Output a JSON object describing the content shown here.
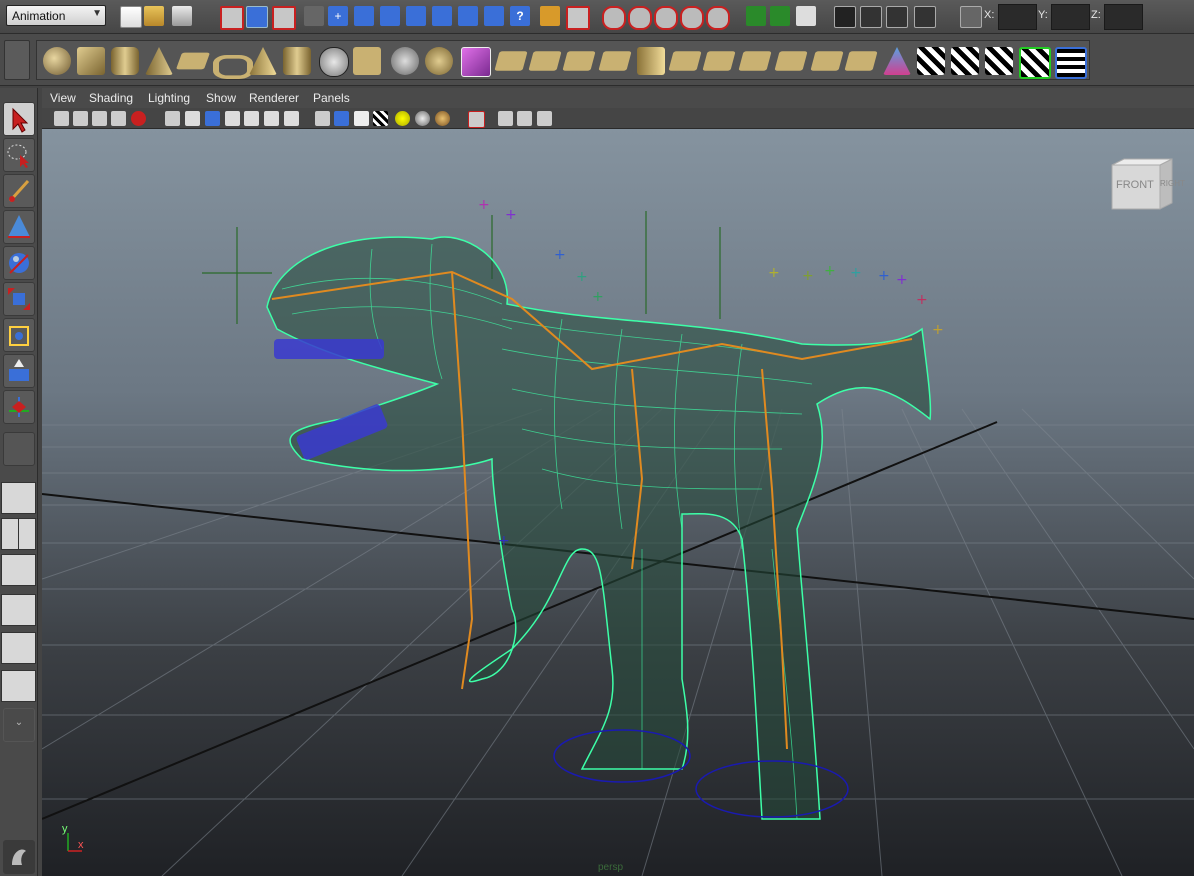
{
  "status_line": {
    "mode": "Animation",
    "coord_labels": [
      "X:",
      "Y:",
      "Z:"
    ]
  },
  "panel": {
    "menus": [
      "View",
      "Shading",
      "Lighting",
      "Show",
      "Renderer",
      "Panels"
    ]
  },
  "viewport": {
    "view_cube_label": "FRONT",
    "view_cube_side": "RIGHT",
    "camera_label": "persp",
    "axis_x": "x",
    "axis_y": "y",
    "background_top": "#85939f",
    "background_bottom": "#1f2125",
    "mesh_color": "#3dffa8",
    "grid_color": "#7f8790"
  },
  "colors": {
    "accent_red": "#c82020",
    "accent_blue": "#3a6fd8",
    "ui_bg": "#4a4a4a"
  },
  "icons": {
    "statusline": [
      "new-scene-icon",
      "open-scene-icon",
      "save-scene-icon",
      "select-by-hierarchy-icon",
      "select-by-object-icon",
      "select-by-component-icon",
      "mask-icon",
      "select-handle-icon",
      "select-joint-icon",
      "select-curve-icon",
      "select-surface-icon",
      "select-deformation-icon",
      "select-dynamic-icon",
      "select-rendering-icon",
      "lock-icon",
      "highlight-icon",
      "snap-grid-icon",
      "snap-curve-icon",
      "snap-point-icon",
      "snap-view-plane-icon",
      "snap-live-icon",
      "input-icon",
      "output-icon",
      "history-icon",
      "render-view-icon",
      "render-frame-icon",
      "ipr-icon",
      "render-settings-icon",
      "input-line-icon"
    ],
    "shelf": [
      "nurbs-sphere-icon",
      "nurbs-cube-icon",
      "nurbs-cylinder-icon",
      "nurbs-cone-icon",
      "nurbs-plane-icon",
      "nurbs-torus-icon",
      "poly-pyramid-icon",
      "poly-cylinder-icon",
      "poly-sphere-icon",
      "extrude-face-icon",
      "poly-wedge-icon",
      "poly-cube-icon",
      "poly-soccer-icon",
      "poly-cube-highlight-icon",
      "subdiv-plane-icon",
      "subdiv-pointer-icon",
      "split-edge-icon",
      "subdiv-face-icon",
      "split-face-icon",
      "collapse-icon",
      "facet-icon",
      "face-cut-icon",
      "edge-move-icon",
      "merge-icon",
      "append-icon",
      "poly-extrude-icon",
      "sculpt-plane-icon",
      "checker-1-icon",
      "checker-2-icon",
      "checker-3-icon",
      "checker-green-icon",
      "checker-grid-icon"
    ],
    "toolbox": [
      "select-tool-icon",
      "lasso-tool-icon",
      "paint-select-icon",
      "move-tool-icon",
      "rotate-tool-icon",
      "scale-tool-icon",
      "universal-manipulator-icon",
      "soft-mod-icon",
      "show-manipulator-icon",
      "last-tool-icon"
    ]
  }
}
